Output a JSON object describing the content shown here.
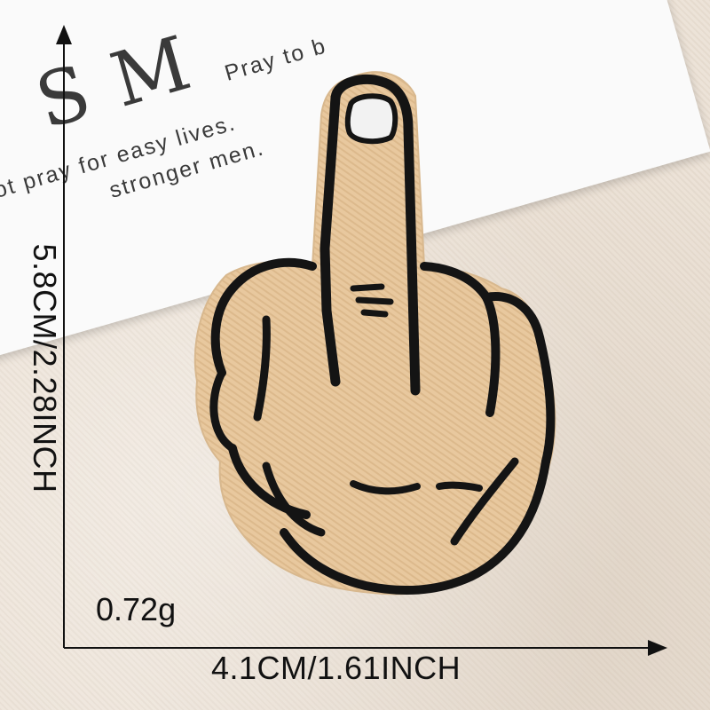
{
  "card": {
    "title_fragment": "S M",
    "line_1": "ot pray for easy lives.",
    "line_2": "stronger men.",
    "line_3": "Pray to b"
  },
  "product": {
    "depicts": "middle-finger-hand-patch",
    "colors": {
      "patch_fill": "#e8c89e",
      "outline": "#141414",
      "nail": "#f2f2f2",
      "background": "#ebe1d5"
    }
  },
  "dimensions": {
    "height_label": "5.8CM/2.28INCH",
    "width_label": "4.1CM/1.61INCH",
    "weight_label": "0.72g"
  }
}
